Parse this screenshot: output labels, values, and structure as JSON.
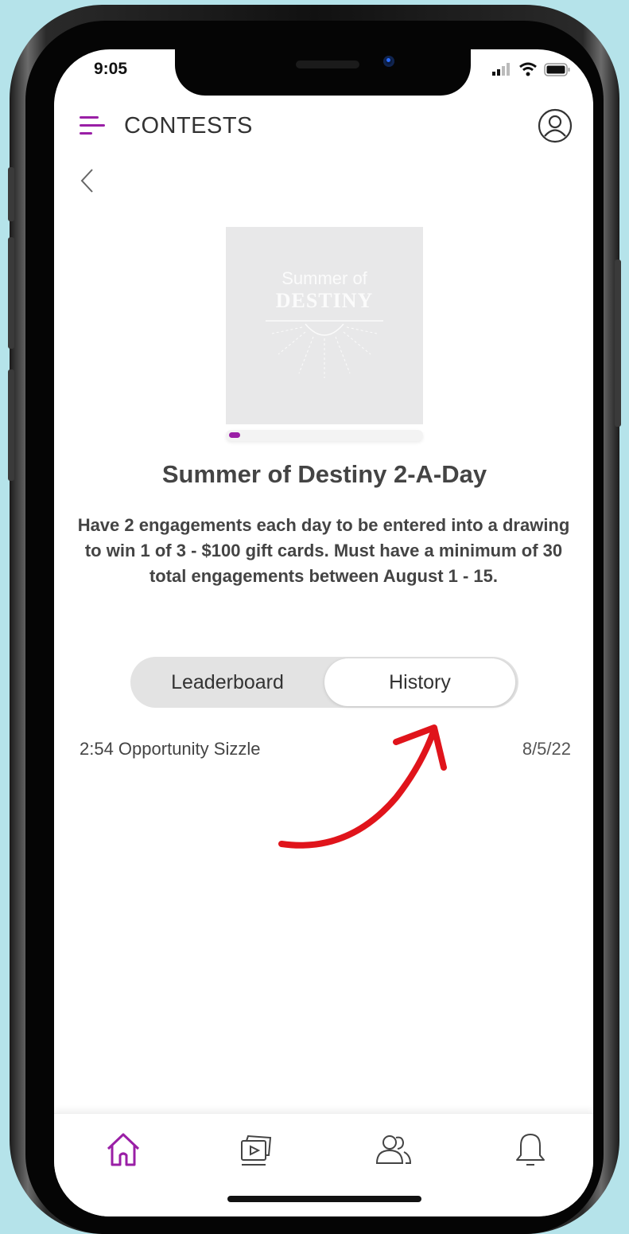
{
  "status_bar": {
    "time": "9:05"
  },
  "header": {
    "title": "CONTESTS"
  },
  "hero": {
    "line1": "Summer of",
    "line2": "DESTINY"
  },
  "contest": {
    "progress": 0.06,
    "title": "Summer of Destiny 2-A-Day",
    "description": "Have 2 engagements each day to be entered into a drawing to win 1 of 3 - $100 gift cards. Must have a minimum of 30 total engagements between August 1 - 15."
  },
  "tabs": {
    "leaderboard": "Leaderboard",
    "history": "History",
    "selected": "History"
  },
  "history": [
    {
      "name": "2:54 Opportunity Sizzle",
      "date": "8/5/22"
    }
  ],
  "colors": {
    "accent": "#9a1fa6",
    "annotation": "#e0141b"
  },
  "bottom_nav": [
    "home-icon",
    "media-icon",
    "people-icon",
    "bell-icon"
  ]
}
